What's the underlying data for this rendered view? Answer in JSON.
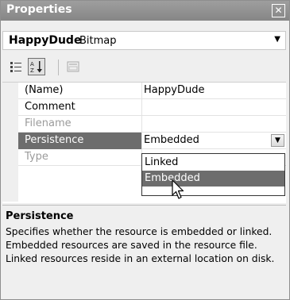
{
  "window": {
    "title": "Properties",
    "close_glyph": "✕"
  },
  "object_selector": {
    "name": "HappyDude",
    "type": "Bitmap"
  },
  "toolbar": {
    "buttons": [
      {
        "icon": "categorized-icon",
        "selected": false
      },
      {
        "icon": "alphabetical-icon",
        "selected": true
      },
      {
        "icon": "property-pages-icon",
        "selected": false
      }
    ]
  },
  "properties": [
    {
      "name": "(Name)",
      "value": "HappyDude",
      "readonly": false
    },
    {
      "name": "Comment",
      "value": "",
      "readonly": false
    },
    {
      "name": "Filename",
      "value": "",
      "readonly": true
    },
    {
      "name": "Persistence",
      "value": "Embedded",
      "readonly": false,
      "selected": true
    },
    {
      "name": "Type",
      "value": "",
      "readonly": true
    }
  ],
  "dropdown": {
    "options": [
      "Linked",
      "Embedded"
    ],
    "highlighted": "Embedded"
  },
  "help": {
    "title": "Persistence",
    "description": "Specifies whether the resource is embedded or linked. Embedded resources are saved in the resource file. Linked resources reside in an external location on disk."
  },
  "colors": {
    "titlebar": "#8f8f8f",
    "selection": "#6d6d6d",
    "readonly_text": "#9b9b9b"
  }
}
